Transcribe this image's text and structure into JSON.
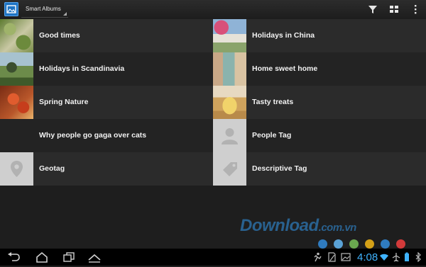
{
  "action_bar": {
    "album_selector": "Smart Albums"
  },
  "albums": [
    {
      "left": "Good times",
      "right": "Holidays in China"
    },
    {
      "left": "Holidays in Scandinavia",
      "right": "Home sweet home"
    },
    {
      "left": "Spring Nature",
      "right": "Tasty treats"
    },
    {
      "left": "Why people go gaga over cats",
      "right": "People Tag"
    },
    {
      "left": "Geotag",
      "right": "Descriptive Tag"
    }
  ],
  "watermark": {
    "text": "Download",
    "suffix": ".com.vn",
    "dot_colors": [
      "#2f7bbf",
      "#5aa2d6",
      "#6aa84f",
      "#d4a017",
      "#2f7bbf",
      "#d23a3a"
    ]
  },
  "status_bar": {
    "time": "4:08"
  },
  "colors": {
    "accent": "#3fb3ff",
    "app_icon": "#1e74c4"
  },
  "icons": [
    "photos-app-icon",
    "filter-icon",
    "view-mode-icon",
    "overflow-menu-icon",
    "back-icon",
    "home-icon",
    "recent-apps-icon",
    "menu-icon",
    "person-icon",
    "location-pin-icon",
    "tag-icon"
  ]
}
